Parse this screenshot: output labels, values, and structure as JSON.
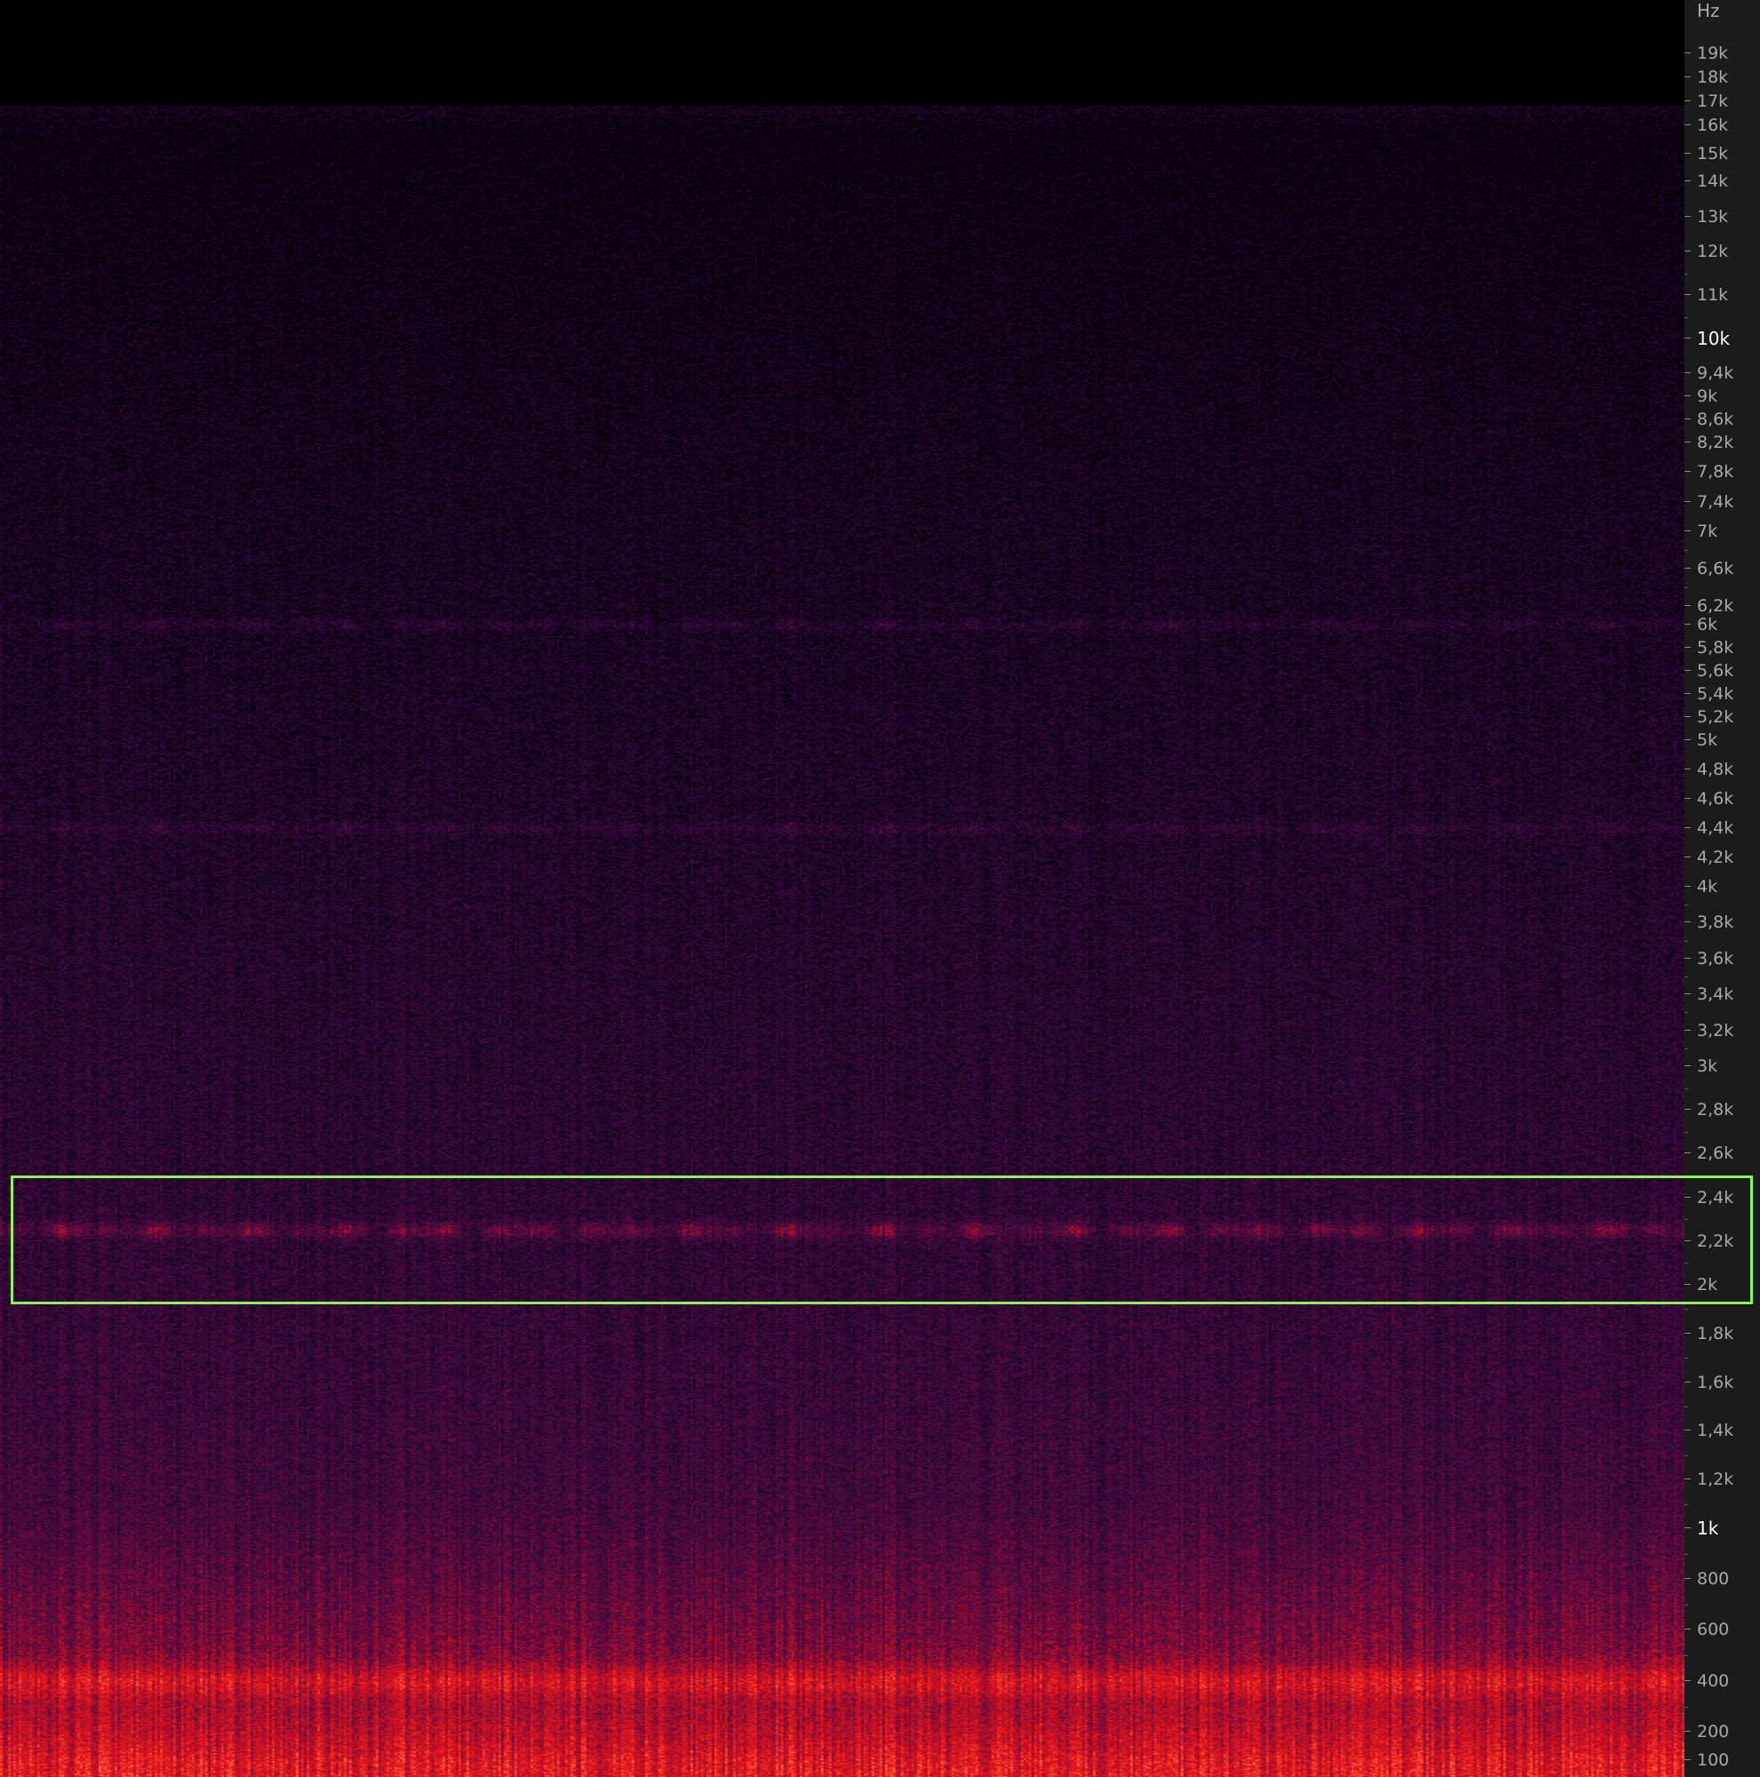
{
  "chart_data": {
    "type": "heatmap",
    "title": "",
    "xlabel": "",
    "ylabel": "",
    "unit": "Hz",
    "scale": "log",
    "ylim": [
      100,
      20000
    ],
    "y_ticks": [
      {
        "value": 100,
        "label": "100"
      },
      {
        "value": 200,
        "label": "200"
      },
      {
        "value": 400,
        "label": "400"
      },
      {
        "value": 600,
        "label": "600"
      },
      {
        "value": 800,
        "label": "800"
      },
      {
        "value": 1000,
        "label": "1k",
        "major": true
      },
      {
        "value": 1200,
        "label": "1,2k"
      },
      {
        "value": 1400,
        "label": "1,4k"
      },
      {
        "value": 1600,
        "label": "1,6k"
      },
      {
        "value": 1800,
        "label": "1,8k"
      },
      {
        "value": 2000,
        "label": "2k"
      },
      {
        "value": 2200,
        "label": "2,2k"
      },
      {
        "value": 2400,
        "label": "2,4k"
      },
      {
        "value": 2600,
        "label": "2,6k"
      },
      {
        "value": 2800,
        "label": "2,8k"
      },
      {
        "value": 3000,
        "label": "3k"
      },
      {
        "value": 3200,
        "label": "3,2k"
      },
      {
        "value": 3400,
        "label": "3,4k"
      },
      {
        "value": 3600,
        "label": "3,6k"
      },
      {
        "value": 3800,
        "label": "3,8k"
      },
      {
        "value": 4000,
        "label": "4k"
      },
      {
        "value": 4200,
        "label": "4,2k"
      },
      {
        "value": 4400,
        "label": "4,4k"
      },
      {
        "value": 4600,
        "label": "4,6k"
      },
      {
        "value": 4800,
        "label": "4,8k"
      },
      {
        "value": 5000,
        "label": "5k"
      },
      {
        "value": 5200,
        "label": "5,2k"
      },
      {
        "value": 5400,
        "label": "5,4k"
      },
      {
        "value": 5600,
        "label": "5,6k"
      },
      {
        "value": 5800,
        "label": "5,8k"
      },
      {
        "value": 6000,
        "label": "6k"
      },
      {
        "value": 6200,
        "label": "6,2k"
      },
      {
        "value": 6600,
        "label": "6,6k"
      },
      {
        "value": 7000,
        "label": "7k"
      },
      {
        "value": 7400,
        "label": "7,4k"
      },
      {
        "value": 7800,
        "label": "7,8k"
      },
      {
        "value": 8200,
        "label": "8,2k"
      },
      {
        "value": 8600,
        "label": "8,6k"
      },
      {
        "value": 9000,
        "label": "9k"
      },
      {
        "value": 9400,
        "label": "9,4k"
      },
      {
        "value": 10000,
        "label": "10k",
        "major": true
      },
      {
        "value": 11000,
        "label": "11k"
      },
      {
        "value": 12000,
        "label": "12k"
      },
      {
        "value": 13000,
        "label": "13k"
      },
      {
        "value": 14000,
        "label": "14k"
      },
      {
        "value": 15000,
        "label": "15k"
      },
      {
        "value": 16000,
        "label": "16k"
      },
      {
        "value": 17000,
        "label": "17k"
      },
      {
        "value": 18000,
        "label": "18k"
      },
      {
        "value": 19000,
        "label": "19k"
      }
    ],
    "content_cutoff_hz": 16700,
    "tonal_bands_hz": [
      2250,
      4400,
      6000
    ],
    "low_energy_band_hz": [
      250,
      1100
    ],
    "colormap": [
      "#000000",
      "#1a0526",
      "#3a0a3e",
      "#6a0a3c",
      "#b0102a",
      "#e8141a",
      "#ff5a3a"
    ],
    "selection": {
      "freq_low_hz": 1920,
      "freq_high_hz": 2500,
      "color": "#8ff25b"
    }
  }
}
